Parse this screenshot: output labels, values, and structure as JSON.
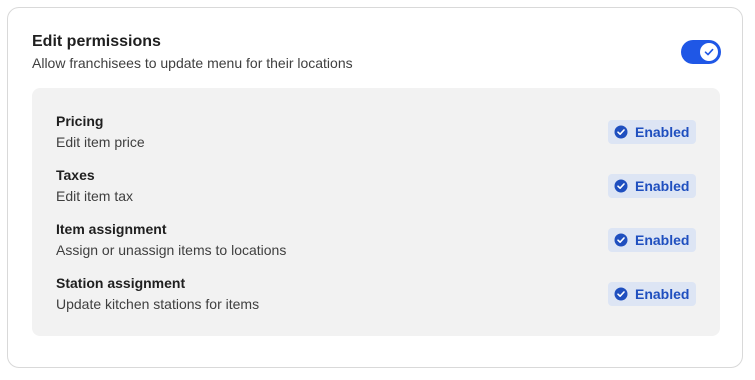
{
  "header": {
    "title": "Edit permissions",
    "subtitle": "Allow franchisees to update menu for their locations"
  },
  "toggle": {
    "state": "on",
    "icon": "check-icon"
  },
  "permissions": [
    {
      "title": "Pricing",
      "description": "Edit item price",
      "status": "Enabled",
      "status_icon": "check-circle-icon"
    },
    {
      "title": "Taxes",
      "description": "Edit item tax",
      "status": "Enabled",
      "status_icon": "check-circle-icon"
    },
    {
      "title": "Item assignment",
      "description": "Assign or unassign items to locations",
      "status": "Enabled",
      "status_icon": "check-circle-icon"
    },
    {
      "title": "Station assignment",
      "description": "Update kitchen stations for items",
      "status": "Enabled",
      "status_icon": "check-circle-icon"
    }
  ],
  "colors": {
    "accent": "#1f57e6",
    "badge_bg": "#dde5f4",
    "badge_text": "#1f4fbf",
    "panel_bg": "#f2f2f2"
  }
}
